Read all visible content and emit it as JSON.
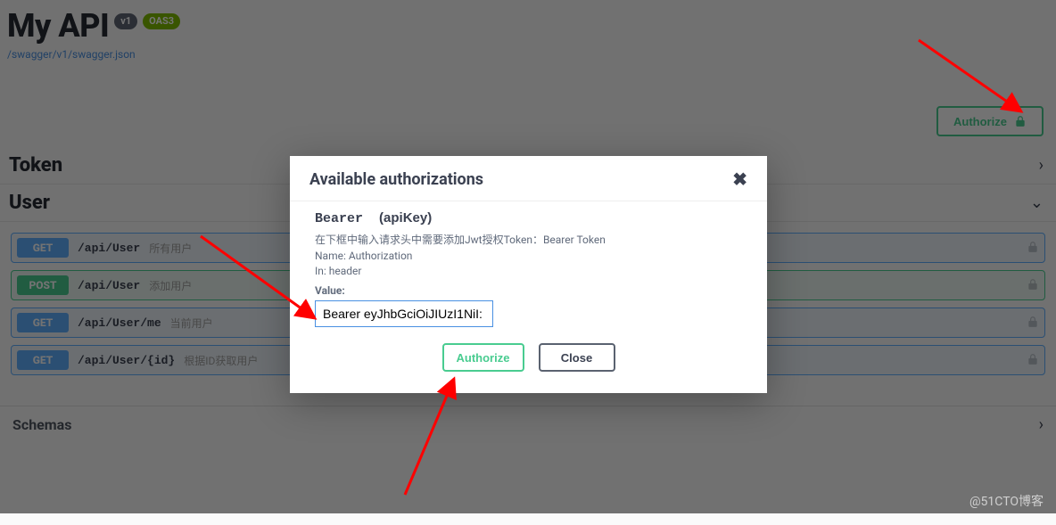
{
  "header": {
    "title": "My API",
    "version_badge": "v1",
    "oas_badge": "OAS3",
    "spec_link": "/swagger/v1/swagger.json"
  },
  "topbar": {
    "authorize_label": "Authorize"
  },
  "tags": [
    {
      "name": "Token",
      "expanded": false
    },
    {
      "name": "User",
      "expanded": true,
      "ops": [
        {
          "method": "GET",
          "path": "/api/User",
          "summary": "所有用户"
        },
        {
          "method": "POST",
          "path": "/api/User",
          "summary": "添加用户"
        },
        {
          "method": "GET",
          "path": "/api/User/me",
          "summary": "当前用户"
        },
        {
          "method": "GET",
          "path": "/api/User/{id}",
          "summary": "根据ID获取用户"
        }
      ]
    }
  ],
  "schemas": {
    "title": "Schemas"
  },
  "modal": {
    "title": "Available authorizations",
    "scheme_name": "Bearer",
    "scheme_type": "(apiKey)",
    "description": "在下框中输入请求头中需要添加Jwt授权Token：Bearer Token",
    "name_label": "Name:",
    "name_value": "Authorization",
    "in_label": "In:",
    "in_value": "header",
    "value_label": "Value:",
    "value_input": "Bearer eyJhbGciOiJIUzI1NiI:",
    "authorize_label": "Authorize",
    "close_label": "Close"
  },
  "watermark": "@51CTO博客"
}
